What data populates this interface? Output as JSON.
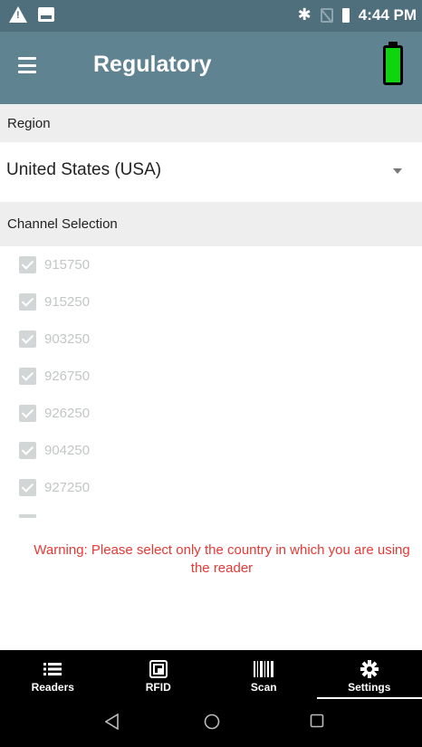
{
  "status_bar": {
    "time": "4:44 PM",
    "icons": [
      "warning-icon",
      "image-icon",
      "bluetooth-icon",
      "no-sim-icon",
      "battery-icon"
    ]
  },
  "app_bar": {
    "title": "Regulatory",
    "reader_battery": {
      "icon": "battery-icon",
      "color": "#0fd40f"
    }
  },
  "region": {
    "header": "Region",
    "selected": "United States (USA)"
  },
  "channels": {
    "header": "Channel Selection",
    "items": [
      {
        "value": "915750",
        "checked": true
      },
      {
        "value": "915250",
        "checked": true
      },
      {
        "value": "903250",
        "checked": true
      },
      {
        "value": "926750",
        "checked": true
      },
      {
        "value": "926250",
        "checked": true
      },
      {
        "value": "904250",
        "checked": true
      },
      {
        "value": "927250",
        "checked": true
      }
    ]
  },
  "warning": "Warning: Please select only the country in which you are using the reader",
  "bottom_nav": {
    "items": [
      {
        "label": "Readers",
        "icon": "list-icon",
        "active": false
      },
      {
        "label": "RFID",
        "icon": "rfid-tag-icon",
        "active": false
      },
      {
        "label": "Scan",
        "icon": "barcode-icon",
        "active": false
      },
      {
        "label": "Settings",
        "icon": "gear-icon",
        "active": true
      }
    ]
  },
  "colors": {
    "status_bar": "#4f6f7d",
    "app_bar": "#5f8391",
    "warning": "#e53935",
    "disabled_text": "#c3c6c6"
  }
}
